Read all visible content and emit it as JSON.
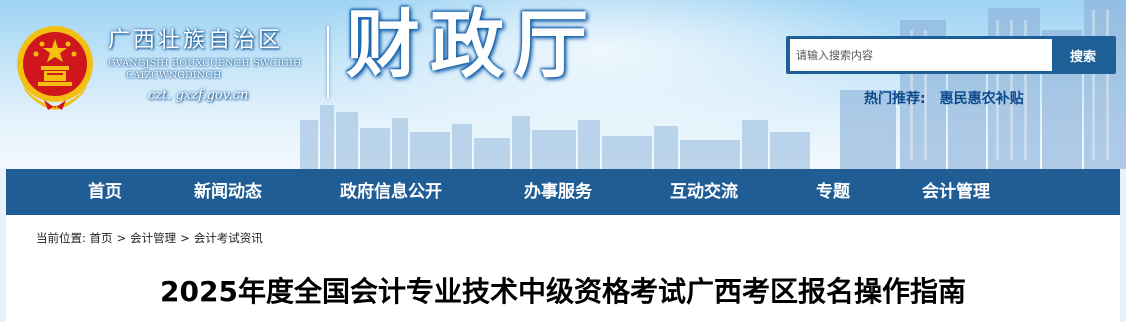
{
  "header": {
    "region_cn": "广西壮族自治区",
    "region_zhuang_line1": "GVANGJSIH BOUXCUENGH SWCIGIH",
    "region_zhuang_line2": "CAIZCWNGDINGH",
    "domain": "czt. gxzf.gov.cn",
    "department": "财政厅"
  },
  "search": {
    "placeholder": "请输入搜索内容",
    "button_label": "搜索"
  },
  "hot": {
    "label": "热门推荐:",
    "link": "惠民惠农补贴"
  },
  "nav": {
    "items": [
      {
        "label": "首页"
      },
      {
        "label": "新闻动态"
      },
      {
        "label": "政府信息公开"
      },
      {
        "label": "办事服务"
      },
      {
        "label": "互动交流"
      },
      {
        "label": "专题"
      },
      {
        "label": "会计管理"
      }
    ]
  },
  "breadcrumb": {
    "label": "当前位置:",
    "items": [
      "首页",
      "会计管理",
      "会计考试资讯"
    ],
    "separator": ">"
  },
  "article": {
    "title": "2025年度全国会计专业技术中级资格考试广西考区报名操作指南"
  },
  "colors": {
    "nav_bg": "#1f5d94",
    "search_btn_bg": "#1d5f96",
    "hot_text": "#0d4a8c",
    "emblem_red": "#d0161d",
    "emblem_gold": "#f3c012"
  }
}
